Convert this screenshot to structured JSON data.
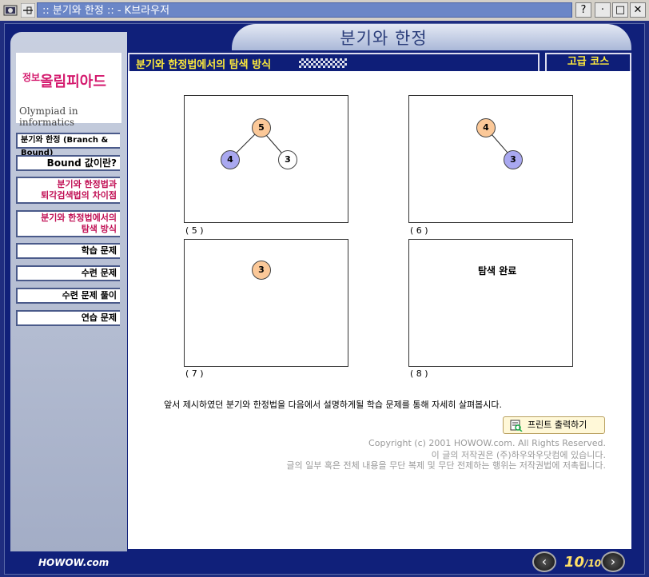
{
  "window": {
    "title": ":: 분기와 한정 :: - K브라우저",
    "buttons": {
      "help": "?",
      "pin": "·",
      "minimize": "-",
      "maximize": "□",
      "close": "✕"
    }
  },
  "header": {
    "title": "분기와 한정"
  },
  "sidebar": {
    "logo_kr_prefix": "정보",
    "logo_kr": "올림피아드",
    "logo_en": "Olympiad in informatics",
    "items": [
      {
        "label": "분기와 한정 (Branch & Bound)"
      },
      {
        "label": "Bound 값이란?"
      },
      {
        "label": "분기와 한정법과",
        "label2": "퇴각검색법의 차이점"
      },
      {
        "label": "분기와 한정법에서의",
        "label2": "탐색 방식"
      },
      {
        "label": "학습 문제"
      },
      {
        "label": "수련 문제"
      },
      {
        "label": "수련 문제 풀이"
      },
      {
        "label": "연습 문제"
      }
    ]
  },
  "section": {
    "title": "분기와 한정법에서의 탐색 방식",
    "course": "고급 코스"
  },
  "panels": [
    {
      "label": "( 5 )",
      "nodes": [
        "5",
        "4",
        "3"
      ]
    },
    {
      "label": "( 6 )",
      "nodes": [
        "4",
        "3"
      ]
    },
    {
      "label": "( 7 )",
      "nodes": [
        "3"
      ]
    },
    {
      "label": "( 8 )",
      "text": "탐색 완료"
    }
  ],
  "description": "앞서 제시하였던 분기와 한정법을 다음에서 설명하게될 학습 문제를 통해 자세히 살펴봅시다.",
  "print_button": "프린트 출력하기",
  "copyright": [
    "Copyright (c) 2001 HOWOW.com. All Rights Reserved.",
    "이 글의 저작권은 (주)하우와우닷컴에 있습니다.",
    "글의 일부 혹은 전체 내용을 무단 복제 및 무단 전제하는 행위는 저작권법에 저촉됩니다."
  ],
  "footer": {
    "logo": "HOWOW.com",
    "page_current": "10",
    "page_total": "10"
  },
  "colors": {
    "node_orange": "#fbc898",
    "node_purple": "#a9a8f0",
    "accent_pink": "#c11055",
    "title_yellow": "#ffeb3b"
  }
}
